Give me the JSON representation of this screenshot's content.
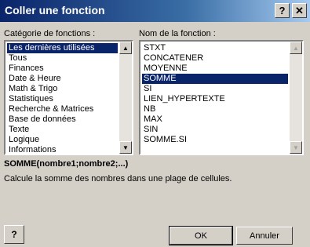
{
  "window": {
    "title": "Coller une fonction"
  },
  "categories": {
    "label": "Catégorie de fonctions :",
    "items": [
      "Les dernières utilisées",
      "Tous",
      "Finances",
      "Date & Heure",
      "Math & Trigo",
      "Statistiques",
      "Recherche & Matrices",
      "Base de données",
      "Texte",
      "Logique",
      "Informations"
    ],
    "selected_index": 0
  },
  "functions": {
    "label": "Nom de la fonction :",
    "items": [
      "STXT",
      "CONCATENER",
      "MOYENNE",
      "SOMME",
      "SI",
      "LIEN_HYPERTEXTE",
      "NB",
      "MAX",
      "SIN",
      "SOMME.SI"
    ],
    "selected_index": 3
  },
  "syntax": "SOMME(nombre1;nombre2;...)",
  "description": "Calcule la somme des nombres dans une plage de cellules.",
  "buttons": {
    "ok": "OK",
    "cancel": "Annuler",
    "help_glyph": "?"
  },
  "titlebar": {
    "help_glyph": "?",
    "close_glyph": "✕"
  },
  "colors": {
    "title_active": "#0a246a",
    "selection": "#0a246a",
    "face": "#d4d0c8"
  }
}
